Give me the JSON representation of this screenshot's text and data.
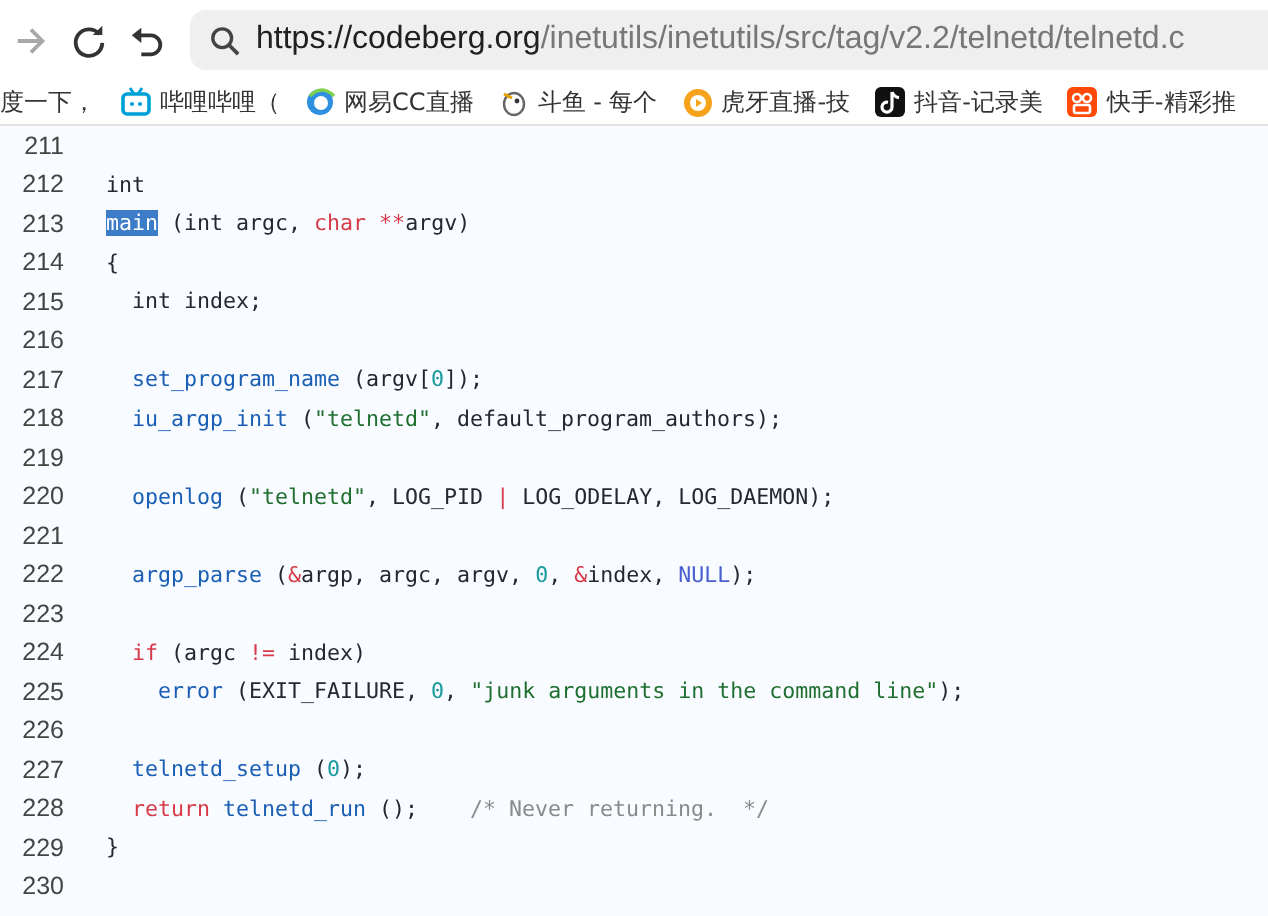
{
  "toolbar": {
    "url": {
      "host": "https://codeberg.org",
      "path": "/inetutils/inetutils/src/tag/v2.2/telnetd/telnetd.c"
    }
  },
  "bookmarks": [
    {
      "label": "度一下，",
      "kind": "none"
    },
    {
      "label": "哔哩哔哩（",
      "kind": "tv"
    },
    {
      "label": "网易CC直播",
      "kind": "swirl"
    },
    {
      "label": "斗鱼 - 每个",
      "kind": "bird"
    },
    {
      "label": "虎牙直播-技",
      "kind": "play"
    },
    {
      "label": "抖音-记录美",
      "kind": "note"
    },
    {
      "label": "快手-精彩推",
      "kind": "camera"
    }
  ],
  "code": [
    {
      "number": "211"
    },
    {
      "number": "212",
      "tokens": [
        {
          "text": "int",
          "kind": "plain"
        }
      ]
    },
    {
      "number": "213",
      "tokens": [
        {
          "text": "main",
          "kind": "highlighted"
        },
        {
          "text": " (int argc, ",
          "kind": "plain"
        },
        {
          "text": "char ",
          "kind": "keyword"
        },
        {
          "text": "**",
          "kind": "operator"
        },
        {
          "text": "argv)",
          "kind": "plain"
        }
      ]
    },
    {
      "number": "214",
      "tokens": [
        {
          "text": "{",
          "kind": "plain"
        }
      ]
    },
    {
      "number": "215",
      "tokens": [
        {
          "text": "  int index;",
          "kind": "plain"
        }
      ]
    },
    {
      "number": "216"
    },
    {
      "number": "217",
      "tokens": [
        {
          "text": "  set_program_name",
          "kind": "function"
        },
        {
          "text": " (argv[",
          "kind": "plain"
        },
        {
          "text": "0",
          "kind": "number"
        },
        {
          "text": "]);",
          "kind": "plain"
        }
      ]
    },
    {
      "number": "218",
      "tokens": [
        {
          "text": "  iu_argp_init",
          "kind": "function"
        },
        {
          "text": " (",
          "kind": "plain"
        },
        {
          "text": "\"telnetd\"",
          "kind": "string"
        },
        {
          "text": ", default_program_authors);",
          "kind": "plain"
        }
      ]
    },
    {
      "number": "219"
    },
    {
      "number": "220",
      "tokens": [
        {
          "text": "  openlog",
          "kind": "function"
        },
        {
          "text": " (",
          "kind": "plain"
        },
        {
          "text": "\"telnetd\"",
          "kind": "string"
        },
        {
          "text": ", LOG_PID ",
          "kind": "plain"
        },
        {
          "text": "|",
          "kind": "operator"
        },
        {
          "text": " LOG_ODELAY, LOG_DAEMON);",
          "kind": "plain"
        }
      ]
    },
    {
      "number": "221"
    },
    {
      "number": "222",
      "tokens": [
        {
          "text": "  argp_parse",
          "kind": "function"
        },
        {
          "text": " (",
          "kind": "plain"
        },
        {
          "text": "&",
          "kind": "operator"
        },
        {
          "text": "argp, argc, argv, ",
          "kind": "plain"
        },
        {
          "text": "0",
          "kind": "number"
        },
        {
          "text": ", ",
          "kind": "plain"
        },
        {
          "text": "&",
          "kind": "operator"
        },
        {
          "text": "index, ",
          "kind": "plain"
        },
        {
          "text": "NULL",
          "kind": "constant"
        },
        {
          "text": ");",
          "kind": "plain"
        }
      ]
    },
    {
      "number": "223"
    },
    {
      "number": "224",
      "tokens": [
        {
          "text": "  if",
          "kind": "keyword"
        },
        {
          "text": " (argc ",
          "kind": "plain"
        },
        {
          "text": "!=",
          "kind": "operator"
        },
        {
          "text": " index)",
          "kind": "plain"
        }
      ]
    },
    {
      "number": "225",
      "tokens": [
        {
          "text": "    error",
          "kind": "function"
        },
        {
          "text": " (EXIT_FAILURE, ",
          "kind": "plain"
        },
        {
          "text": "0",
          "kind": "number"
        },
        {
          "text": ", ",
          "kind": "plain"
        },
        {
          "text": "\"junk arguments in the command line\"",
          "kind": "string"
        },
        {
          "text": ");",
          "kind": "plain"
        }
      ]
    },
    {
      "number": "226"
    },
    {
      "number": "227",
      "tokens": [
        {
          "text": "  telnetd_setup",
          "kind": "function"
        },
        {
          "text": " (",
          "kind": "plain"
        },
        {
          "text": "0",
          "kind": "number"
        },
        {
          "text": ");",
          "kind": "plain"
        }
      ]
    },
    {
      "number": "228",
      "tokens": [
        {
          "text": "  return ",
          "kind": "keyword"
        },
        {
          "text": "telnetd_run",
          "kind": "function"
        },
        {
          "text": " ();    ",
          "kind": "plain"
        },
        {
          "text": "/* Never returning.  */",
          "kind": "comment"
        }
      ]
    },
    {
      "number": "229",
      "tokens": [
        {
          "text": "}",
          "kind": "plain"
        }
      ]
    },
    {
      "number": "230"
    }
  ]
}
